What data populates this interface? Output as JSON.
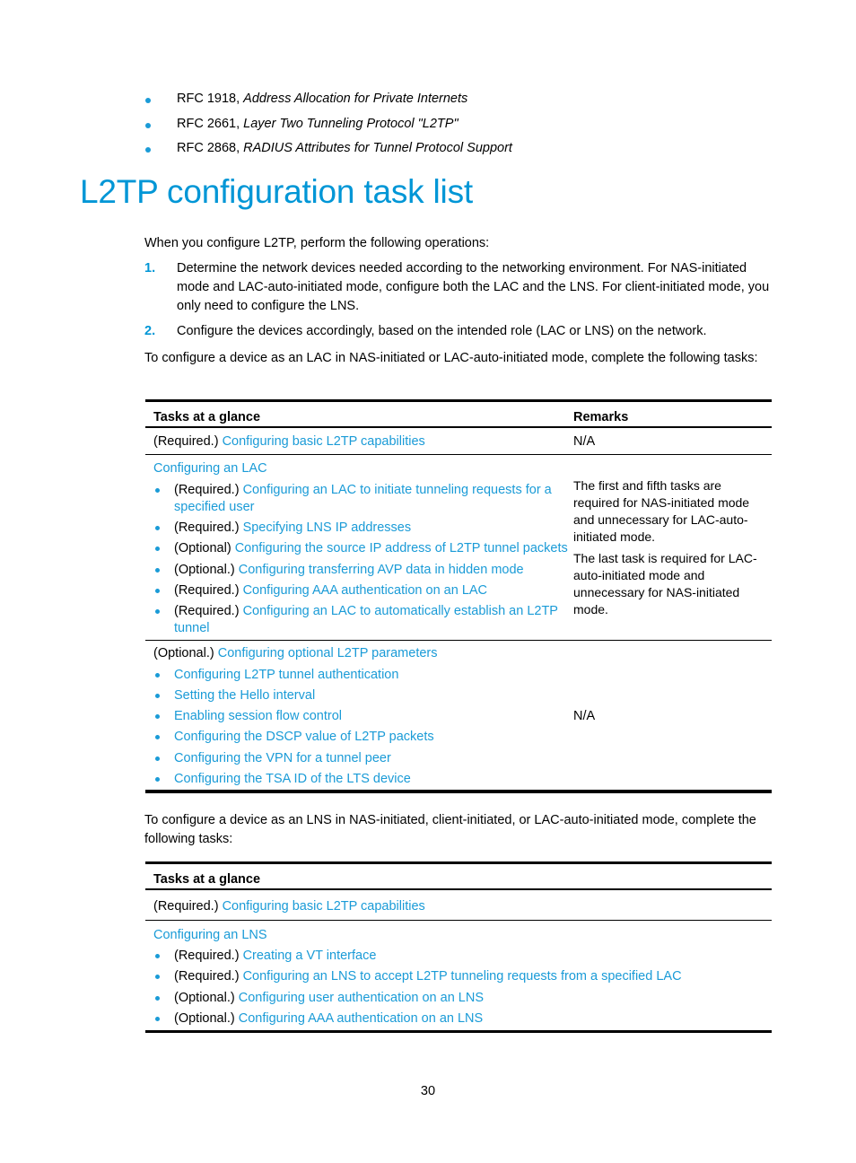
{
  "references": [
    {
      "prefix": "RFC 1918, ",
      "title": "Address Allocation for Private Internets"
    },
    {
      "prefix": "RFC 2661, ",
      "title": "Layer Two Tunneling Protocol \"L2TP\""
    },
    {
      "prefix": "RFC 2868, ",
      "title": "RADIUS Attributes for Tunnel Protocol Support"
    }
  ],
  "section_title": "L2TP configuration task list",
  "intro": "When you configure L2TP, perform the following operations:",
  "steps": [
    {
      "num": "1.",
      "text": "Determine the network devices needed according to the networking environment. For NAS-initiated mode and LAC-auto-initiated mode, configure both the LAC and the LNS. For client-initiated mode, you only need to configure the LNS."
    },
    {
      "num": "2.",
      "text": "Configure the devices accordingly, based on the intended role (LAC or LNS) on the network."
    }
  ],
  "lac_intro": "To configure a device as an LAC in NAS-initiated or LAC-auto-initiated mode, complete the following tasks:",
  "lac_table": {
    "headers": {
      "tasks": "Tasks at a glance",
      "remarks": "Remarks"
    },
    "row1": {
      "prefix": "(Required.) ",
      "link": "Configuring basic L2TP capabilities",
      "remark": "N/A"
    },
    "row2": {
      "heading": "Configuring an LAC",
      "items": [
        {
          "prefix": "(Required.) ",
          "link_line1": "Configuring an LAC to initiate tunneling requests for a",
          "link_line2": "specified user"
        },
        {
          "prefix": "(Required.) ",
          "link_line1": "Specifying LNS IP addresses"
        },
        {
          "prefix": "(Optional) ",
          "link_line1": "Configuring the source IP address of L2TP tunnel packets"
        },
        {
          "prefix": "(Optional.) ",
          "link_line1": "Configuring transferring AVP data in hidden mode"
        },
        {
          "prefix": "(Required.) ",
          "link_line1": "Configuring AAA authentication on an LAC"
        },
        {
          "prefix": "(Required.) ",
          "link_line1": "Configuring an LAC to automatically establish an L2TP",
          "link_line2": "tunnel"
        }
      ],
      "remarks": [
        "The first and fifth tasks are required for NAS-initiated mode and unnecessary for LAC-auto-initiated mode.",
        "The last task is required for LAC-auto-initiated mode and unnecessary for NAS-initiated mode."
      ]
    },
    "row3": {
      "prefix": "(Optional.) ",
      "link": "Configuring optional L2TP parameters",
      "items": [
        "Configuring L2TP tunnel authentication",
        "Setting the Hello interval",
        "Enabling session flow control",
        "Configuring the DSCP value of L2TP packets",
        "Configuring the VPN for a tunnel peer",
        "Configuring the TSA ID of the LTS device"
      ],
      "remark": "N/A"
    }
  },
  "lns_intro": "To configure a device as an LNS in NAS-initiated, client-initiated, or LAC-auto-initiated mode, complete the following tasks:",
  "lns_table": {
    "headers": {
      "tasks": "Tasks at a glance"
    },
    "row1": {
      "prefix": "(Required.) ",
      "link": "Configuring basic L2TP capabilities"
    },
    "row2": {
      "heading": "Configuring an LNS",
      "items": [
        {
          "prefix": "(Required.) ",
          "link": "Creating a VT interface"
        },
        {
          "prefix": "(Required.) ",
          "link": "Configuring an LNS to accept L2TP tunneling requests from a specified LAC"
        },
        {
          "prefix": "(Optional.) ",
          "link": "Configuring user authentication on an LNS"
        },
        {
          "prefix": "(Optional.) ",
          "link": "Configuring AAA authentication on an LNS"
        }
      ]
    }
  },
  "page_number": "30",
  "colors": {
    "heading": "#0096d6",
    "link": "#1a9bd7",
    "bullet": "#1a9bd7"
  }
}
